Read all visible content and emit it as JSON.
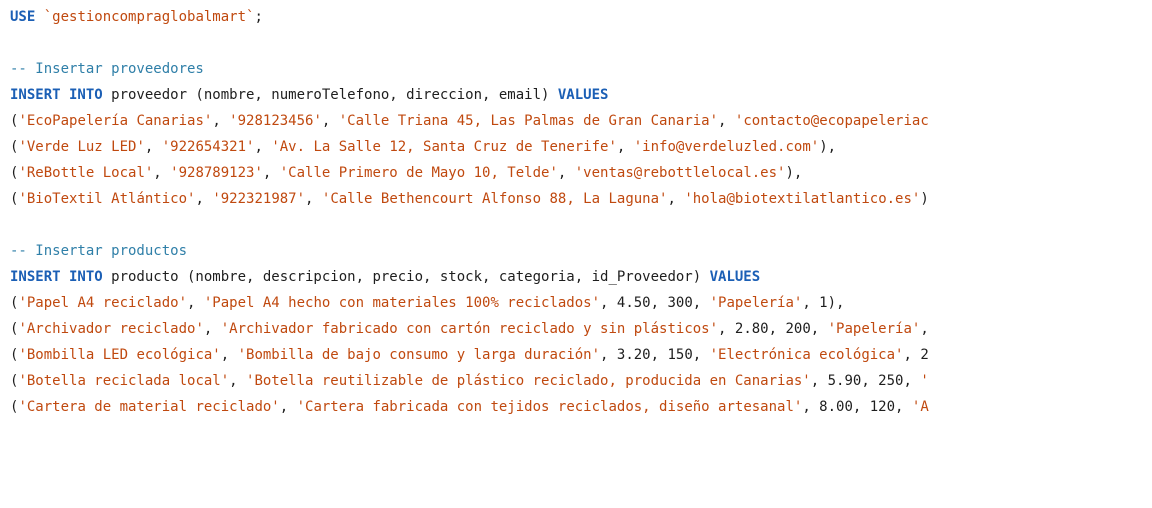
{
  "colors": {
    "keyword": "#1b5fb5",
    "string": "#c0490f",
    "comment": "#2f7fa8",
    "text": "#1e1e1e",
    "background": "#ffffff"
  },
  "code_lines": [
    [
      {
        "type": "kw",
        "text": "USE"
      },
      {
        "type": "tx",
        "text": " "
      },
      {
        "type": "str",
        "text": "`gestioncompraglobalmart`"
      },
      {
        "type": "tx",
        "text": ";"
      }
    ],
    [],
    [
      {
        "type": "cm",
        "text": "-- Insertar proveedores"
      }
    ],
    [
      {
        "type": "kw",
        "text": "INSERT INTO"
      },
      {
        "type": "tx",
        "text": " proveedor (nombre, numeroTelefono, direccion, email) "
      },
      {
        "type": "kw",
        "text": "VALUES"
      }
    ],
    [
      {
        "type": "tx",
        "text": "("
      },
      {
        "type": "str",
        "text": "'EcoPapelería Canarias'"
      },
      {
        "type": "tx",
        "text": ", "
      },
      {
        "type": "str",
        "text": "'928123456'"
      },
      {
        "type": "tx",
        "text": ", "
      },
      {
        "type": "str",
        "text": "'Calle Triana 45, Las Palmas de Gran Canaria'"
      },
      {
        "type": "tx",
        "text": ", "
      },
      {
        "type": "str",
        "text": "'contacto@ecopapeleriac"
      }
    ],
    [
      {
        "type": "tx",
        "text": "("
      },
      {
        "type": "str",
        "text": "'Verde Luz LED'"
      },
      {
        "type": "tx",
        "text": ", "
      },
      {
        "type": "str",
        "text": "'922654321'"
      },
      {
        "type": "tx",
        "text": ", "
      },
      {
        "type": "str",
        "text": "'Av. La Salle 12, Santa Cruz de Tenerife'"
      },
      {
        "type": "tx",
        "text": ", "
      },
      {
        "type": "str",
        "text": "'info@verdeluzled.com'"
      },
      {
        "type": "tx",
        "text": "),"
      }
    ],
    [
      {
        "type": "tx",
        "text": "("
      },
      {
        "type": "str",
        "text": "'ReBottle Local'"
      },
      {
        "type": "tx",
        "text": ", "
      },
      {
        "type": "str",
        "text": "'928789123'"
      },
      {
        "type": "tx",
        "text": ", "
      },
      {
        "type": "str",
        "text": "'Calle Primero de Mayo 10, Telde'"
      },
      {
        "type": "tx",
        "text": ", "
      },
      {
        "type": "str",
        "text": "'ventas@rebottlelocal.es'"
      },
      {
        "type": "tx",
        "text": "),"
      }
    ],
    [
      {
        "type": "tx",
        "text": "("
      },
      {
        "type": "str",
        "text": "'BioTextil Atlántico'"
      },
      {
        "type": "tx",
        "text": ", "
      },
      {
        "type": "str",
        "text": "'922321987'"
      },
      {
        "type": "tx",
        "text": ", "
      },
      {
        "type": "str",
        "text": "'Calle Bethencourt Alfonso 88, La Laguna'"
      },
      {
        "type": "tx",
        "text": ", "
      },
      {
        "type": "str",
        "text": "'hola@biotextilatlantico.es'"
      },
      {
        "type": "tx",
        "text": ")"
      }
    ],
    [],
    [
      {
        "type": "cm",
        "text": "-- Insertar productos"
      }
    ],
    [
      {
        "type": "kw",
        "text": "INSERT INTO"
      },
      {
        "type": "tx",
        "text": " producto (nombre, descripcion, precio, stock, categoria, id_Proveedor) "
      },
      {
        "type": "kw",
        "text": "VALUES"
      }
    ],
    [
      {
        "type": "tx",
        "text": "("
      },
      {
        "type": "str",
        "text": "'Papel A4 reciclado'"
      },
      {
        "type": "tx",
        "text": ", "
      },
      {
        "type": "str",
        "text": "'Papel A4 hecho con materiales 100% reciclados'"
      },
      {
        "type": "tx",
        "text": ", 4.50, 300, "
      },
      {
        "type": "str",
        "text": "'Papelería'"
      },
      {
        "type": "tx",
        "text": ", 1),"
      }
    ],
    [
      {
        "type": "tx",
        "text": "("
      },
      {
        "type": "str",
        "text": "'Archivador reciclado'"
      },
      {
        "type": "tx",
        "text": ", "
      },
      {
        "type": "str",
        "text": "'Archivador fabricado con cartón reciclado y sin plásticos'"
      },
      {
        "type": "tx",
        "text": ", 2.80, 200, "
      },
      {
        "type": "str",
        "text": "'Papelería'"
      },
      {
        "type": "tx",
        "text": ","
      }
    ],
    [
      {
        "type": "tx",
        "text": "("
      },
      {
        "type": "str",
        "text": "'Bombilla LED ecológica'"
      },
      {
        "type": "tx",
        "text": ", "
      },
      {
        "type": "str",
        "text": "'Bombilla de bajo consumo y larga duración'"
      },
      {
        "type": "tx",
        "text": ", 3.20, 150, "
      },
      {
        "type": "str",
        "text": "'Electrónica ecológica'"
      },
      {
        "type": "tx",
        "text": ", 2"
      }
    ],
    [
      {
        "type": "tx",
        "text": "("
      },
      {
        "type": "str",
        "text": "'Botella reciclada local'"
      },
      {
        "type": "tx",
        "text": ", "
      },
      {
        "type": "str",
        "text": "'Botella reutilizable de plástico reciclado, producida en Canarias'"
      },
      {
        "type": "tx",
        "text": ", 5.90, 250, "
      },
      {
        "type": "str",
        "text": "'"
      }
    ],
    [
      {
        "type": "tx",
        "text": "("
      },
      {
        "type": "str",
        "text": "'Cartera de material reciclado'"
      },
      {
        "type": "tx",
        "text": ", "
      },
      {
        "type": "str",
        "text": "'Cartera fabricada con tejidos reciclados, diseño artesanal'"
      },
      {
        "type": "tx",
        "text": ", 8.00, 120, "
      },
      {
        "type": "str",
        "text": "'A"
      }
    ]
  ]
}
